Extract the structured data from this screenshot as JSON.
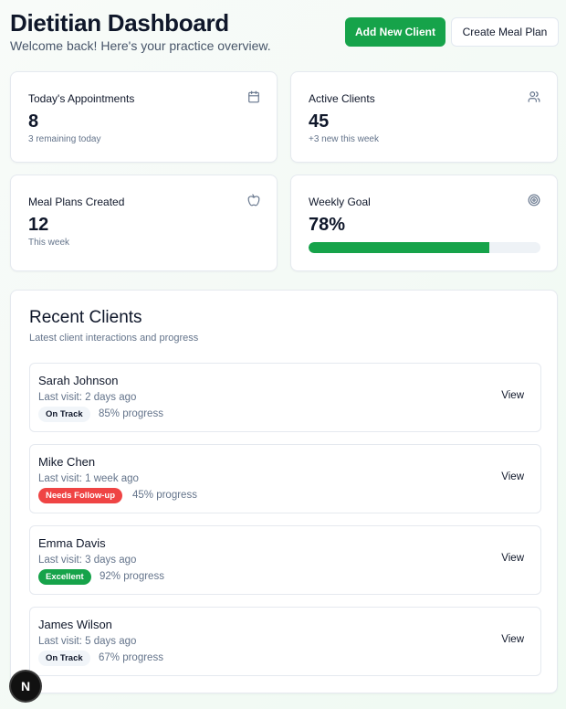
{
  "header": {
    "title": "Dietitian Dashboard",
    "subtitle": "Welcome back! Here's your practice overview.",
    "primary_button": "Add New Client",
    "secondary_button": "Create Meal Plan"
  },
  "stats": [
    {
      "label": "Today's Appointments",
      "value": "8",
      "sub": "3 remaining today",
      "icon": "calendar-icon"
    },
    {
      "label": "Active Clients",
      "value": "45",
      "sub": "+3 new this week",
      "icon": "users-icon"
    },
    {
      "label": "Meal Plans Created",
      "value": "12",
      "sub": "This week",
      "icon": "apple-icon"
    },
    {
      "label": "Weekly Goal",
      "value": "78%",
      "progress": 78,
      "icon": "target-icon"
    }
  ],
  "recent": {
    "title": "Recent Clients",
    "subtitle": "Latest client interactions and progress",
    "clients": [
      {
        "name": "Sarah Johnson",
        "visit": "Last visit: 2 days ago",
        "status": "On Track",
        "progress": "85% progress",
        "action": "View"
      },
      {
        "name": "Mike Chen",
        "visit": "Last visit: 1 week ago",
        "status": "Needs Follow-up",
        "progress": "45% progress",
        "action": "View"
      },
      {
        "name": "Emma Davis",
        "visit": "Last visit: 3 days ago",
        "status": "Excellent",
        "progress": "92% progress",
        "action": "View"
      },
      {
        "name": "James Wilson",
        "visit": "Last visit: 5 days ago",
        "status": "On Track",
        "progress": "67% progress",
        "action": "View"
      }
    ]
  },
  "colors": {
    "accent": "#16a34a",
    "danger": "#ef4444",
    "muted_text": "#64748b"
  },
  "dev_badge": "N"
}
